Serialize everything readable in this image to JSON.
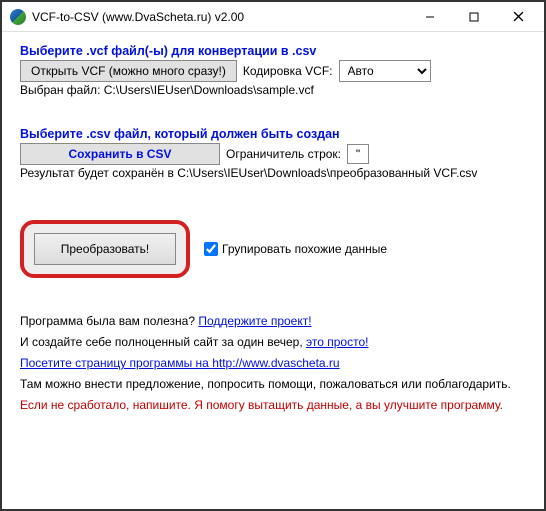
{
  "window": {
    "title": "VCF-to-CSV (www.DvaScheta.ru) v2.00"
  },
  "section1": {
    "heading": "Выберите .vcf файл(-ы) для конвертации в .csv",
    "open_btn": "Открыть VCF (можно много сразу!)",
    "encoding_label": "Кодировка VCF:",
    "encoding_value": "Авто",
    "selected_file": "Выбран файл: C:\\Users\\IEUser\\Downloads\\sample.vcf"
  },
  "section2": {
    "heading": "Выберите .csv файл, который должен быть создан",
    "save_btn": "Сохранить в CSV",
    "delimiter_label": "Ограничитель строк:",
    "delimiter_value": "\"",
    "result_line": "Результат будет сохранён в C:\\Users\\IEUser\\Downloads\\преобразованный VCF.csv"
  },
  "convert": {
    "button": "Преобразовать!",
    "group_checkbox": "Групировать похожие данные",
    "group_checked": true
  },
  "footer": {
    "useful_prefix": "Программа была вам полезна?  ",
    "support_link": "Поддержите проект!",
    "site_prefix": "И создайте себе полноценный сайт за один вечер, ",
    "site_link": "это просто!",
    "visit_prefix": "Посетите страницу программы на ",
    "visit_link": "http://www.dvascheta.ru",
    "suggestion": "Там можно внести предложение, попросить помощи, пожаловаться или поблагодарить.",
    "fallback": "Если не сработало, напишите. Я помогу вытащить данные, а вы улучшите программу."
  }
}
